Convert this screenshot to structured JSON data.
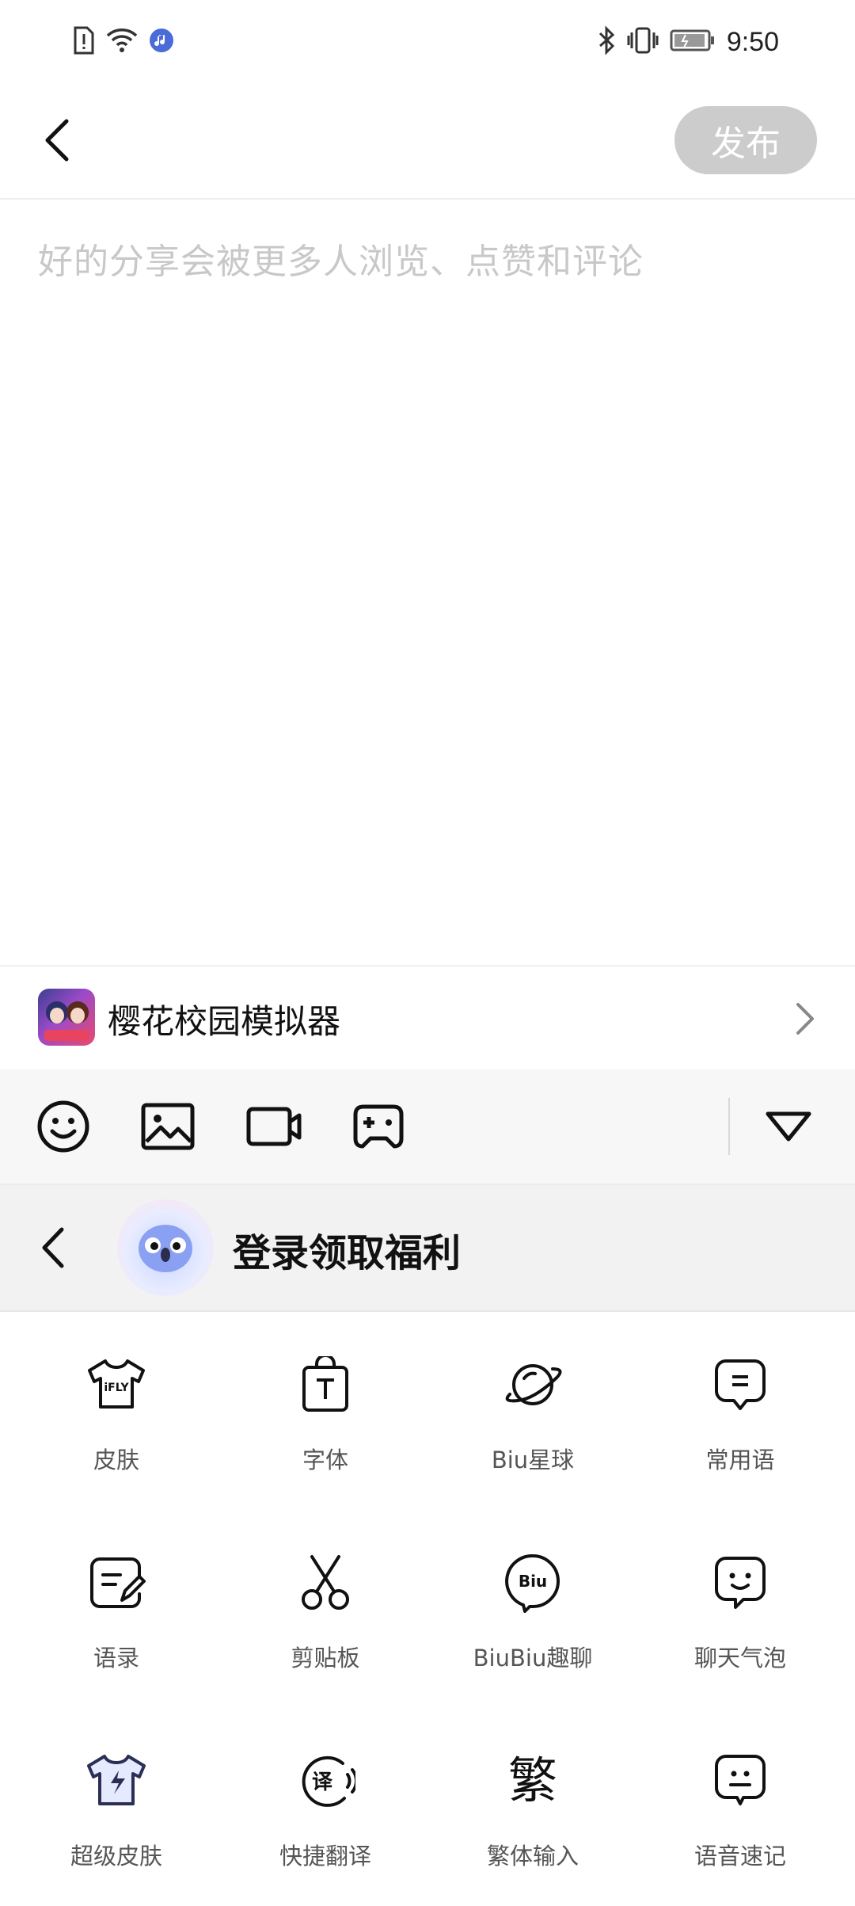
{
  "status_bar": {
    "time": "9:50",
    "left_icons": [
      "sim-alert-icon",
      "wifi-icon",
      "music-app-icon"
    ],
    "right_icons": [
      "bluetooth-icon",
      "vibrate-icon",
      "battery-icon"
    ]
  },
  "header": {
    "back_icon": "chevron-left-icon",
    "publish_label": "发布"
  },
  "editor": {
    "placeholder": "好的分享会被更多人浏览、点赞和评论"
  },
  "game": {
    "name": "樱花校园模拟器"
  },
  "toolbar": {
    "items": [
      "emoji-icon",
      "image-icon",
      "video-icon",
      "gamepad-icon"
    ],
    "collapse_icon": "triangle-down-icon"
  },
  "keyboard_header": {
    "login_text": "登录领取福利"
  },
  "keyboard_grid": {
    "items": [
      {
        "label": "皮肤",
        "icon": "tshirt-iflytek-icon"
      },
      {
        "label": "字体",
        "icon": "font-bag-icon"
      },
      {
        "label": "Biu星球",
        "icon": "planet-icon"
      },
      {
        "label": "常用语",
        "icon": "phrase-bubble-icon"
      },
      {
        "label": "语录",
        "icon": "quote-note-icon"
      },
      {
        "label": "剪贴板",
        "icon": "scissors-icon"
      },
      {
        "label": "BiuBiu趣聊",
        "icon": "biu-bubble-icon"
      },
      {
        "label": "聊天气泡",
        "icon": "smile-bubble-icon"
      },
      {
        "label": "超级皮肤",
        "icon": "lightning-tshirt-icon"
      },
      {
        "label": "快捷翻译",
        "icon": "translate-icon"
      },
      {
        "label": "繁体输入",
        "icon": "traditional-char-icon"
      },
      {
        "label": "语音速记",
        "icon": "voice-note-icon"
      }
    ],
    "glyph_traditional": "繁",
    "glyph_translate": "译"
  },
  "colors": {
    "publish_bg": "#cccccc",
    "placeholder": "#c8c8c8",
    "toolbar_bg": "#f7f7f7",
    "keyboard_header_bg": "#f2f2f2"
  }
}
